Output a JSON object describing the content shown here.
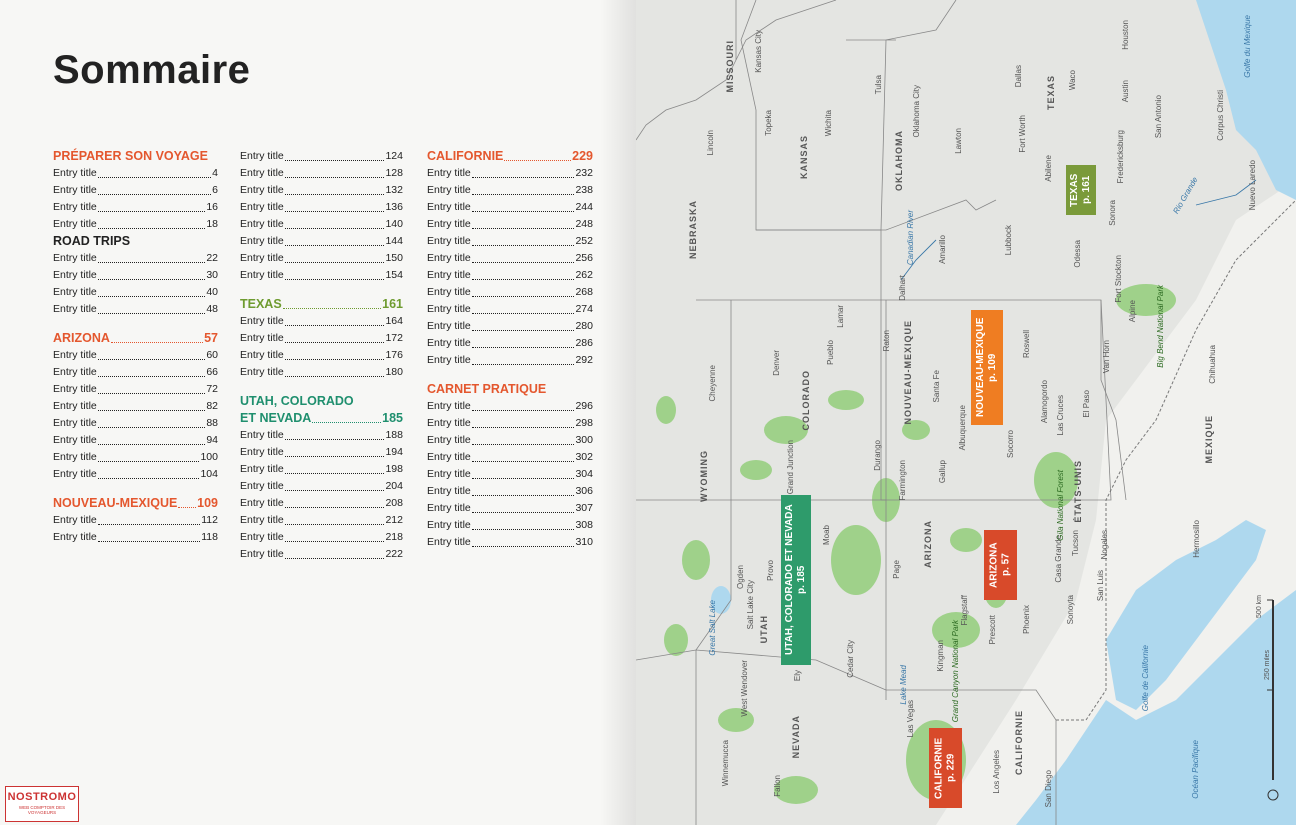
{
  "page": {
    "title": "Sommaire"
  },
  "toc": {
    "col1": [
      {
        "kind": "sec",
        "color": "orange",
        "text": "PRÉPARER SON VOYAGE"
      },
      {
        "kind": "ent",
        "lines": [
          "Entry title"
        ],
        "page": "4"
      },
      {
        "kind": "ent",
        "lines": [
          "Entry title"
        ],
        "page": "6"
      },
      {
        "kind": "ent",
        "lines": [
          "Entry title"
        ],
        "page": "16"
      },
      {
        "kind": "ent",
        "lines": [
          "Entry title"
        ],
        "page": "18"
      },
      {
        "kind": "sec",
        "color": "black",
        "text": "ROAD TRIPS"
      },
      {
        "kind": "ent",
        "lines": [
          "Entry title"
        ],
        "page": "22"
      },
      {
        "kind": "ent",
        "lines": [
          "Entry title"
        ],
        "page": "30"
      },
      {
        "kind": "ent",
        "lines": [
          "Entry title"
        ],
        "page": "40"
      },
      {
        "kind": "ent",
        "lines": [
          "Entry title"
        ],
        "page": "48"
      },
      {
        "kind": "gap"
      },
      {
        "kind": "sec",
        "color": "orange",
        "text": "ARIZONA",
        "page": "57",
        "dotted": true
      },
      {
        "kind": "ent",
        "lines": [
          "Entry title"
        ],
        "page": "60"
      },
      {
        "kind": "ent",
        "lines": [
          "Entry title"
        ],
        "page": "66"
      },
      {
        "kind": "ent",
        "lines": [
          "Entry title"
        ],
        "page": "72"
      },
      {
        "kind": "ent",
        "lines": [
          "Entry title"
        ],
        "page": "82"
      },
      {
        "kind": "ent",
        "lines": [
          "Entry title"
        ],
        "page": "88"
      },
      {
        "kind": "ent",
        "lines": [
          "Entry title"
        ],
        "page": "94"
      },
      {
        "kind": "ent",
        "lines": [
          "Entry title"
        ],
        "page": "100"
      },
      {
        "kind": "ent",
        "lines": [
          "Entry title"
        ],
        "page": "104"
      },
      {
        "kind": "gap"
      },
      {
        "kind": "sec",
        "color": "orange",
        "text": "NOUVEAU-MEXIQUE",
        "page": "109",
        "dotted": true
      },
      {
        "kind": "ent",
        "lines": [
          "Entry title"
        ],
        "page": "112"
      },
      {
        "kind": "ent",
        "lines": [
          "Entry title"
        ],
        "page": "118"
      }
    ],
    "col2": [
      {
        "kind": "ent",
        "lines": [
          "Entry title"
        ],
        "page": "124"
      },
      {
        "kind": "ent",
        "lines": [
          "Entry title"
        ],
        "page": "128"
      },
      {
        "kind": "ent",
        "lines": [
          "Entry title"
        ],
        "page": "132"
      },
      {
        "kind": "ent",
        "lines": [
          "Entry title"
        ],
        "page": "136"
      },
      {
        "kind": "ent",
        "lines": [
          "Entry title"
        ],
        "page": "140"
      },
      {
        "kind": "ent",
        "lines": [
          "Entry title"
        ],
        "page": "144"
      },
      {
        "kind": "ent",
        "lines": [
          "Entry title"
        ],
        "page": "150"
      },
      {
        "kind": "ent",
        "lines": [
          "Entry title"
        ],
        "page": "154"
      },
      {
        "kind": "gap"
      },
      {
        "kind": "sec",
        "color": "green",
        "text": "TEXAS",
        "page": "161",
        "dotted": true
      },
      {
        "kind": "ent",
        "lines": [
          "Entry title"
        ],
        "page": "164"
      },
      {
        "kind": "ent",
        "lines": [
          "Entry title"
        ],
        "page": "172"
      },
      {
        "kind": "ent",
        "lines": [
          "Entry title"
        ],
        "page": "176"
      },
      {
        "kind": "ent",
        "lines": [
          "Entry title"
        ],
        "page": "180"
      },
      {
        "kind": "gap"
      },
      {
        "kind": "sec",
        "color": "teal",
        "text": "UTAH, COLORADO"
      },
      {
        "kind": "sec",
        "color": "teal",
        "text": "ET NEVADA",
        "page": "185",
        "dotted": true
      },
      {
        "kind": "ent",
        "lines": [
          "Entry title"
        ],
        "page": "188"
      },
      {
        "kind": "ent",
        "lines": [
          "Entry title"
        ],
        "page": "194"
      },
      {
        "kind": "ent",
        "lines": [
          "Entry title"
        ],
        "page": "198"
      },
      {
        "kind": "ent",
        "lines": [
          "Entry title"
        ],
        "page": "204"
      },
      {
        "kind": "ent",
        "lines": [
          "Entry title"
        ],
        "page": "208"
      },
      {
        "kind": "ent",
        "lines": [
          "Entry title"
        ],
        "page": "212"
      },
      {
        "kind": "ent",
        "lines": [
          "Entry title"
        ],
        "page": "218"
      },
      {
        "kind": "ent",
        "lines": [
          "Entry title"
        ],
        "page": "222"
      }
    ],
    "col3": [
      {
        "kind": "sec",
        "color": "orange",
        "text": "CALIFORNIE",
        "page": "229",
        "dotted": true
      },
      {
        "kind": "ent",
        "lines": [
          "Entry title"
        ],
        "page": "232"
      },
      {
        "kind": "ent",
        "lines": [
          "Entry title"
        ],
        "page": "238"
      },
      {
        "kind": "ent",
        "lines": [
          "Entry title"
        ],
        "page": "244"
      },
      {
        "kind": "ent",
        "lines": [
          "Entry title"
        ],
        "page": "248"
      },
      {
        "kind": "ent",
        "lines": [
          "Entry title"
        ],
        "page": "252"
      },
      {
        "kind": "ent",
        "lines": [
          "Entry title"
        ],
        "page": "256"
      },
      {
        "kind": "ent",
        "lines": [
          "Entry title"
        ],
        "page": "262"
      },
      {
        "kind": "ent",
        "lines": [
          "Entry title"
        ],
        "page": "268"
      },
      {
        "kind": "ent",
        "lines": [
          "Entry title"
        ],
        "page": "274"
      },
      {
        "kind": "ent",
        "lines": [
          "Entry title"
        ],
        "page": "280"
      },
      {
        "kind": "ent",
        "lines": [
          "Entry title"
        ],
        "page": "286"
      },
      {
        "kind": "ent",
        "lines": [
          "Entry title"
        ],
        "page": "292"
      },
      {
        "kind": "gap"
      },
      {
        "kind": "sec",
        "color": "orange",
        "text": "CARNET PRATIQUE"
      },
      {
        "kind": "ent",
        "lines": [
          "Entry title"
        ],
        "page": "296"
      },
      {
        "kind": "ent",
        "lines": [
          "Entry title"
        ],
        "page": "298"
      },
      {
        "kind": "ent",
        "lines": [
          "Entry title"
        ],
        "page": "300"
      },
      {
        "kind": "ent",
        "lines": [
          "Entry title"
        ],
        "page": "302"
      },
      {
        "kind": "ent",
        "lines": [
          "Entry title"
        ],
        "page": "304"
      },
      {
        "kind": "ent",
        "lines": [
          "Entry title"
        ],
        "page": "306"
      },
      {
        "kind": "ent",
        "lines": [
          "Entry title"
        ],
        "page": "307"
      },
      {
        "kind": "ent",
        "lines": [
          "Entry title"
        ],
        "page": "308"
      },
      {
        "kind": "ent",
        "lines": [
          "Entry title"
        ],
        "page": "310"
      }
    ]
  },
  "map": {
    "badges": {
      "texas": {
        "title": "TEXAS",
        "page": "p. 161",
        "color": "#7a9a3a"
      },
      "nm": {
        "title": "NOUVEAU-MEXIQUE",
        "page": "p. 109",
        "color": "#ef7d22"
      },
      "ucn": {
        "title": "UTAH, COLORADO ET NEVADA",
        "page": "p. 185",
        "color": "#2e9b6b"
      },
      "arizona": {
        "title": "ARIZONA",
        "page": "p. 57",
        "color": "#d84a2a"
      },
      "california": {
        "title": "CALIFORNIE",
        "page": "p. 229",
        "color": "#d84a2a"
      }
    },
    "states": {
      "missouri": "MISSOURI",
      "kansas": "KANSAS",
      "oklahoma": "OKLAHOMA",
      "nebraska": "NEBRASKA",
      "texas": "TEXAS",
      "nm": "NOUVEAU-MEXIQUE",
      "colorado": "COLORADO",
      "wyoming": "WYOMING",
      "utah": "UTAH",
      "arizona": "ARIZONA",
      "nevada": "NEVADA",
      "california": "CALIFORNIE",
      "usa": "ÉTATS-UNIS",
      "mexico": "MEXIQUE"
    },
    "cities": {
      "kansascity": "Kansas City",
      "topeka": "Topeka",
      "wichita": "Wichita",
      "lincoln": "Lincoln",
      "tulsa": "Tulsa",
      "okc": "Oklahoma City",
      "lawton": "Lawton",
      "dallas": "Dallas",
      "fortworth": "Fort Worth",
      "waco": "Waco",
      "houston": "Houston",
      "austin": "Austin",
      "sanantonio": "San Antonio",
      "corpus": "Corpus Christi",
      "abilene": "Abilene",
      "fredericksburg": "Fredericksburg",
      "lubbock": "Lubbock",
      "amarillo": "Amarillo",
      "odessa": "Odessa",
      "fortstockton": "Fort Stockton",
      "sonora": "Sonora",
      "nuevolaredo": "Nuevo Laredo",
      "alpine": "Alpine",
      "vanhorn": "Van Horn",
      "elpaso": "El Paso",
      "chihuahua": "Chihuahua",
      "hermosillo": "Hermosillo",
      "nogales": "Nogales",
      "tucson": "Tucson",
      "phoenix": "Phoenix",
      "flagstaff": "Flagstaff",
      "kingman": "Kingman",
      "prescott": "Prescott",
      "yuma": "Yuma",
      "sandiego": "San Diego",
      "losangeles": "Los Angeles",
      "lasvegas": "Las Vegas",
      "denver": "Denver",
      "pueblo": "Pueblo",
      "lamar": "Lamar",
      "cheyenne": "Cheyenne",
      "gj": "Grand Junction",
      "durango": "Durango",
      "farmington": "Farmington",
      "gallup": "Gallup",
      "albuquerque": "Albuquerque",
      "santafe": "Santa Fe",
      "socorro": "Socorro",
      "roswell": "Roswell",
      "alamogordo": "Alamogordo",
      "lascruces": "Las Cruces",
      "raton": "Raton",
      "slc": "Salt Lake City",
      "ogden": "Ogden",
      "provo": "Provo",
      "moab": "Moab",
      "cedar": "Cedar City",
      "ely": "Ely",
      "winnemucca": "Winnemucca",
      "fallon": "Fallon",
      "wendover": "West Wendover",
      "page": "Page",
      "dalhart": "Dalhart",
      "casagrande": "Casa Grande",
      "sonoyta": "Sonoyta",
      "sanluis": "San Luis"
    },
    "water": {
      "gulfmex": "Golfe du Mexique",
      "gulfcal": "Golfe de Californie",
      "pacific": "Océan Pacifique",
      "greatsalt": "Great Salt Lake",
      "lakemead": "Lake Mead",
      "riogrande": "Rio Grande",
      "canadian": "Canadian River"
    },
    "parks": {
      "bigbend": "Big Bend National Park",
      "gc": "Grand Canyon National Park",
      "gila": "Gila National Forest"
    },
    "scale": {
      "km": "500 km",
      "miles": "250 miles"
    },
    "colors": {
      "land": "#e4e5e2",
      "mexico": "#f1f1ee",
      "water": "#aed8ee",
      "park": "#9fd18a",
      "border": "#888888"
    }
  },
  "logo": {
    "name": "NOSTROMO",
    "tagline": "WEB COMPTOIR DES VOYAGEURS"
  }
}
